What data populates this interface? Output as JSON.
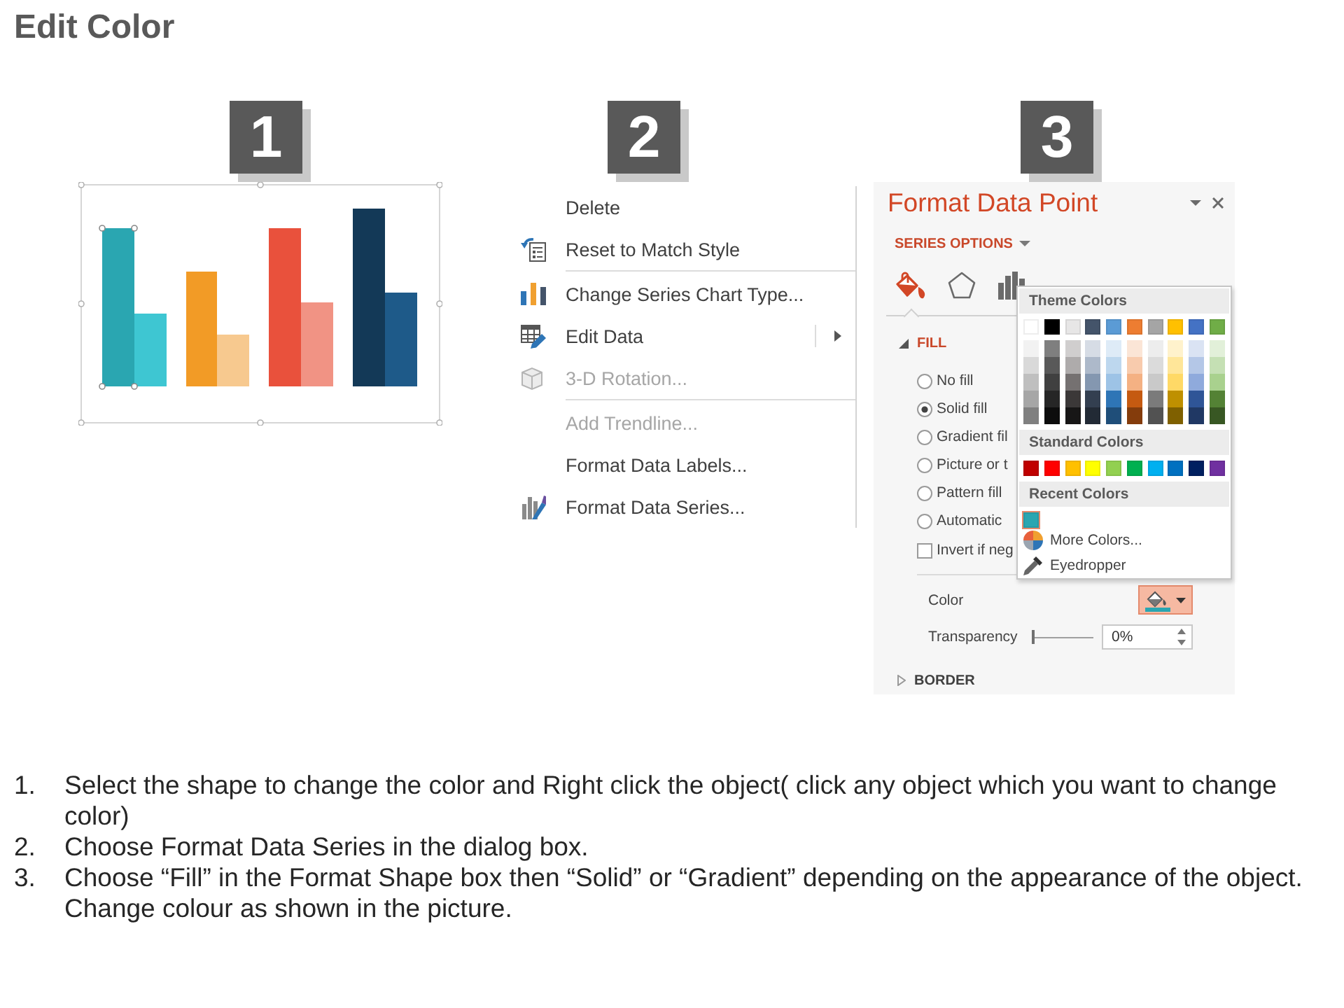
{
  "title": "Edit Color",
  "step_badges": [
    "1",
    "2",
    "3"
  ],
  "context_menu": {
    "items": [
      {
        "label": "Delete",
        "separator": false,
        "disabled": false,
        "submenu": false
      },
      {
        "label": "Reset to Match Style",
        "separator": false,
        "disabled": false,
        "submenu": false
      },
      {
        "label": "Change Series Chart Type...",
        "separator": true,
        "disabled": false,
        "submenu": false
      },
      {
        "label": "Edit Data",
        "separator": false,
        "disabled": false,
        "submenu": true
      },
      {
        "label": "3-D Rotation...",
        "separator": false,
        "disabled": true,
        "submenu": false
      },
      {
        "label": "Add Trendline...",
        "separator": true,
        "disabled": true,
        "submenu": false
      },
      {
        "label": "Format Data Labels...",
        "separator": false,
        "disabled": false,
        "submenu": false
      },
      {
        "label": "Format Data Series...",
        "separator": false,
        "disabled": false,
        "submenu": false
      }
    ]
  },
  "format_pane": {
    "title": "Format Data Point",
    "series_options": "SERIES OPTIONS",
    "tabs": [
      {
        "selected": true
      },
      {
        "selected": false
      },
      {
        "selected": false
      }
    ],
    "fill": {
      "heading": "FILL",
      "expanded": true,
      "options": [
        {
          "label": "No fill",
          "selected": false
        },
        {
          "label": "Solid fill",
          "selected": true
        },
        {
          "label": "Gradient fil",
          "selected": false
        },
        {
          "label": "Picture or t",
          "selected": false
        },
        {
          "label": "Pattern fill",
          "selected": false
        },
        {
          "label": "Automatic",
          "selected": false
        }
      ],
      "invert": {
        "label": "Invert if neg",
        "checked": false
      },
      "color": {
        "label": "Color",
        "expanded": true
      },
      "transparency": {
        "label": "Transparency",
        "level": 0,
        "value": "0%"
      }
    },
    "border": {
      "heading": "BORDER",
      "expanded": false
    }
  },
  "color_picker": {
    "theme_heading": "Theme Colors",
    "theme_colors": [
      {
        "color": "#ffffff",
        "shades": [
          {
            "color": "#f2f2f2"
          },
          {
            "color": "#d9d9d9"
          },
          {
            "color": "#bfbfbf"
          },
          {
            "color": "#a6a6a6"
          },
          {
            "color": "#808080"
          }
        ]
      },
      {
        "color": "#000000",
        "shades": [
          {
            "color": "#7f7f7f"
          },
          {
            "color": "#595959"
          },
          {
            "color": "#404040"
          },
          {
            "color": "#262626"
          },
          {
            "color": "#0d0d0d"
          }
        ]
      },
      {
        "color": "#e7e6e6",
        "shades": [
          {
            "color": "#d0cece"
          },
          {
            "color": "#aeabab"
          },
          {
            "color": "#757171"
          },
          {
            "color": "#3b3838"
          },
          {
            "color": "#171616"
          }
        ]
      },
      {
        "color": "#44546a",
        "shades": [
          {
            "color": "#d6dce5"
          },
          {
            "color": "#adb9ca"
          },
          {
            "color": "#8497b0"
          },
          {
            "color": "#333f50"
          },
          {
            "color": "#222a35"
          }
        ]
      },
      {
        "color": "#5b9bd5",
        "shades": [
          {
            "color": "#deebf7"
          },
          {
            "color": "#bdd7ee"
          },
          {
            "color": "#9dc3e6"
          },
          {
            "color": "#2e75b6"
          },
          {
            "color": "#1f4e79"
          }
        ]
      },
      {
        "color": "#ed7d31",
        "shades": [
          {
            "color": "#fbe5d6"
          },
          {
            "color": "#f8cbad"
          },
          {
            "color": "#f4b183"
          },
          {
            "color": "#c55a11"
          },
          {
            "color": "#843c0c"
          }
        ]
      },
      {
        "color": "#a5a5a5",
        "shades": [
          {
            "color": "#ededed"
          },
          {
            "color": "#dbdbdb"
          },
          {
            "color": "#c9c9c9"
          },
          {
            "color": "#7b7b7b"
          },
          {
            "color": "#525252"
          }
        ]
      },
      {
        "color": "#ffc000",
        "shades": [
          {
            "color": "#fff2cc"
          },
          {
            "color": "#ffe699"
          },
          {
            "color": "#ffd966"
          },
          {
            "color": "#bf9000"
          },
          {
            "color": "#7f6000"
          }
        ]
      },
      {
        "color": "#4472c4",
        "shades": [
          {
            "color": "#dae3f3"
          },
          {
            "color": "#b4c7e7"
          },
          {
            "color": "#8faadc"
          },
          {
            "color": "#2f5597"
          },
          {
            "color": "#203864"
          }
        ]
      },
      {
        "color": "#70ad47",
        "shades": [
          {
            "color": "#e2f0d9"
          },
          {
            "color": "#c5e0b4"
          },
          {
            "color": "#a9d18e"
          },
          {
            "color": "#548235"
          },
          {
            "color": "#385723"
          }
        ]
      }
    ],
    "standard_heading": "Standard Colors",
    "standard_colors": [
      {
        "color": "#c00000"
      },
      {
        "color": "#ff0000"
      },
      {
        "color": "#ffc000"
      },
      {
        "color": "#ffff00"
      },
      {
        "color": "#92d050"
      },
      {
        "color": "#00b050"
      },
      {
        "color": "#00b0f0"
      },
      {
        "color": "#0070c0"
      },
      {
        "color": "#002060"
      },
      {
        "color": "#7030a0"
      }
    ],
    "recent_heading": "Recent Colors",
    "recent_colors": [
      {
        "color": "#2aa6b1"
      }
    ],
    "more_colors": "More Colors...",
    "eyedropper": "Eyedropper"
  },
  "instructions": [
    {
      "number": "1.",
      "text": "Select the shape to change the color and Right click the object( click any object which you want to change color)"
    },
    {
      "number": "2.",
      "text": "Choose Format Data Series in the dialog box."
    },
    {
      "number": "3.",
      "text": "Choose “Fill” in the Format Shape box then “Solid” or “Gradient” depending on the appearance of the object. Change colour as shown in the picture."
    }
  ]
}
